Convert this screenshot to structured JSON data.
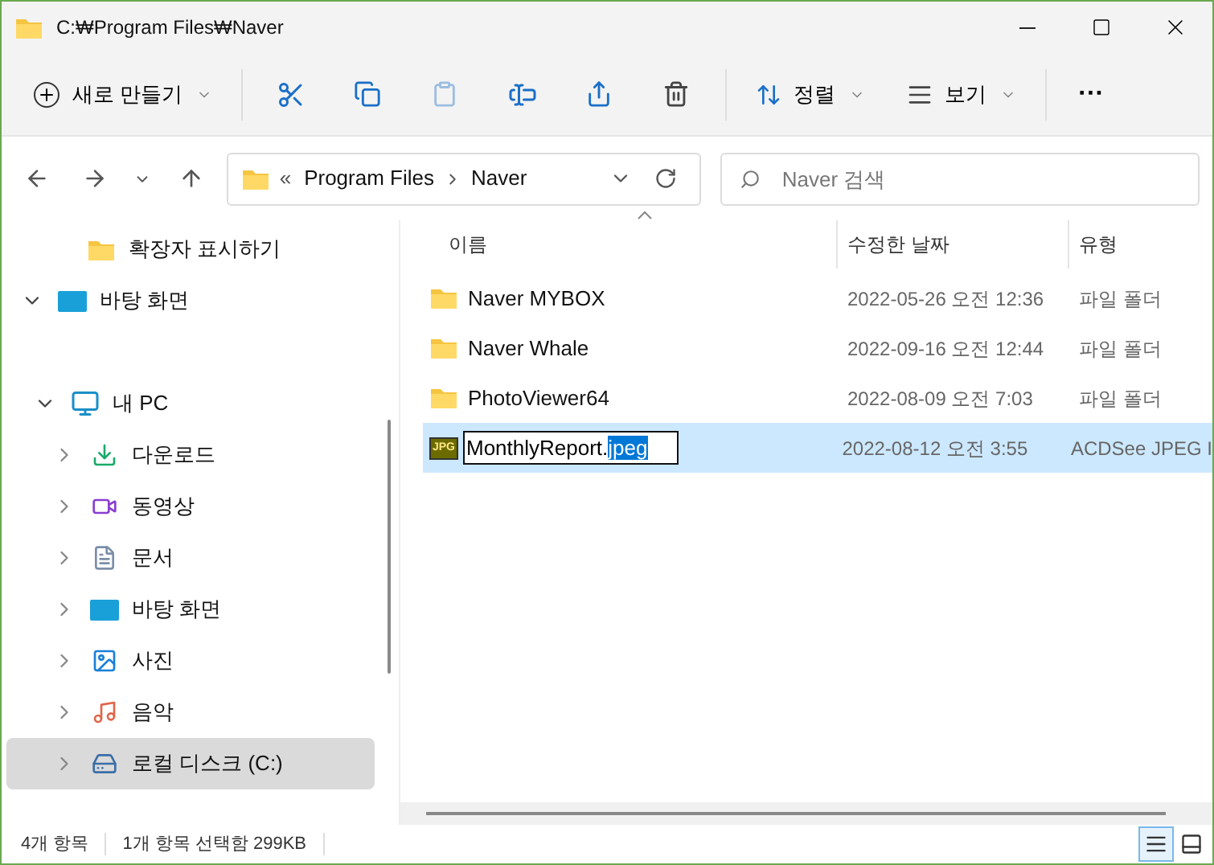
{
  "window": {
    "title": "C:₩Program Files₩Naver"
  },
  "toolbar": {
    "new_button": "새로 만들기",
    "sort_button": "정렬",
    "view_button": "보기",
    "more_button": "···",
    "paste_disabled": true
  },
  "address": {
    "overflow": "«",
    "path": [
      "Program Files",
      "Naver"
    ]
  },
  "search": {
    "placeholder": "Naver 검색"
  },
  "sidebar": {
    "items": [
      {
        "label": "확장자 표시하기",
        "kind": "folder",
        "selected": false
      },
      {
        "label": "바탕 화면",
        "kind": "desktop",
        "expanded": true,
        "selected": false
      },
      {
        "label": "내 PC",
        "kind": "pc",
        "expanded": true,
        "selected": false,
        "children": [
          {
            "label": "다운로드",
            "kind": "download",
            "expanded": false,
            "selected": false
          },
          {
            "label": "동영상",
            "kind": "video",
            "expanded": false,
            "selected": false
          },
          {
            "label": "문서",
            "kind": "document",
            "expanded": false,
            "selected": false
          },
          {
            "label": "바탕 화면",
            "kind": "desktop",
            "expanded": false,
            "selected": false
          },
          {
            "label": "사진",
            "kind": "picture",
            "expanded": false,
            "selected": false
          },
          {
            "label": "음악",
            "kind": "music",
            "expanded": false,
            "selected": false
          },
          {
            "label": "로컬 디스크 (C:)",
            "kind": "drive",
            "expanded": false,
            "selected": true
          }
        ]
      }
    ]
  },
  "table": {
    "columns": [
      "이름",
      "수정한 날짜",
      "유형"
    ],
    "rows": [
      {
        "kind": "folder",
        "name": "Naver MYBOX",
        "date": "2022-05-26 오전 12:36",
        "type": "파일 폴더",
        "selected": false
      },
      {
        "kind": "folder",
        "name": "Naver Whale",
        "date": "2022-09-16 오전 12:44",
        "type": "파일 폴더",
        "selected": false
      },
      {
        "kind": "folder",
        "name": "PhotoViewer64",
        "date": "2022-08-09 오전 7:03",
        "type": "파일 폴더",
        "selected": false
      },
      {
        "kind": "image",
        "name": "MonthlyReport.",
        "name_selected_part": "jpeg",
        "renaming": true,
        "icon_text": "JPG",
        "date": "2022-08-12 오전 3:55",
        "type": "ACDSee JPEG I",
        "selected": true
      }
    ]
  },
  "status_bar": {
    "item_count": "4개 항목",
    "selection": "1개 항목 선택함 299KB"
  }
}
